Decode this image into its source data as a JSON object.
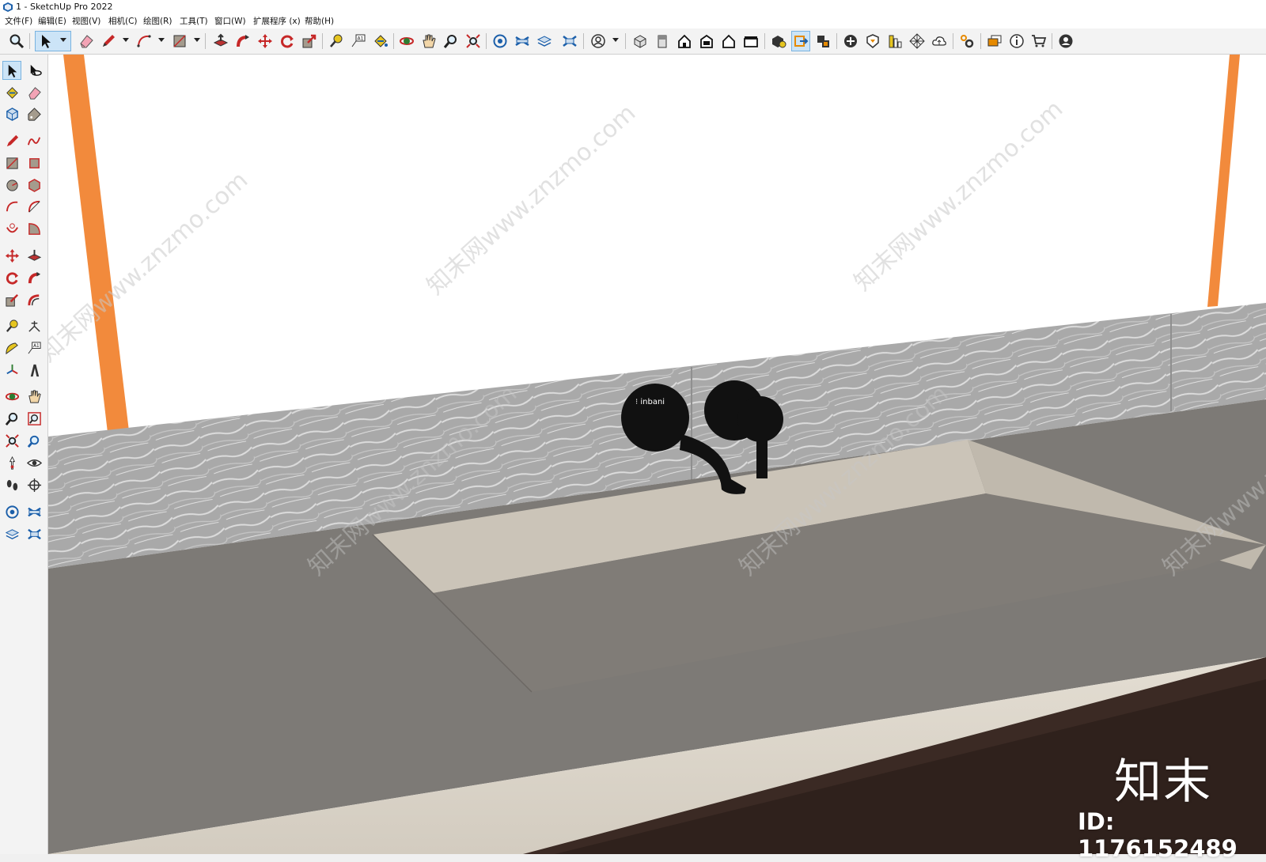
{
  "window": {
    "title": "1 - SketchUp Pro 2022"
  },
  "menu": [
    "文件(F)",
    "编辑(E)",
    "视图(V)",
    "相机(C)",
    "绘图(R)",
    "工具(T)",
    "窗口(W)",
    "扩展程序 (x)",
    "帮助(H)"
  ],
  "toolbar": {
    "tools": [
      "zoom-icon",
      "select-icon",
      "eraser-icon",
      "pencil-icon",
      "arc-icon",
      "rectangle-icon",
      "push-pull-icon",
      "follow-me-icon",
      "move-icon",
      "rotate-icon",
      "scale-icon",
      "tape-measure-icon",
      "text-icon",
      "paint-bucket-icon",
      "orbit-icon",
      "pan-icon",
      "zoom-icon-2",
      "zoom-extents-icon",
      "3d-warehouse-icon",
      "extension-warehouse-icon",
      "layout-icon",
      "extension-manager-icon",
      "profile-icon",
      "iso-view-icon",
      "top-view-icon",
      "front-view-icon",
      "right-view-icon",
      "back-view-icon",
      "left-view-icon",
      "solid-inspector-icon",
      "section-plane-icon",
      "display-section-icon",
      "add-location-icon",
      "sandbox-icon",
      "shadows-icon",
      "styles-icon",
      "cloud-icon",
      "preferences-icon",
      "entity-info-icon",
      "model-info-icon",
      "store-icon",
      "account-icon"
    ]
  },
  "left_toolbar": {
    "tools": [
      "select-icon",
      "orbit-icon",
      "paint-bucket-icon",
      "eraser-icon",
      "make-component-icon",
      "tag-icon",
      "line-icon",
      "freehand-icon",
      "rectangle-icon",
      "rotated-rectangle-icon",
      "circle-icon",
      "polygon-icon",
      "arc-icon",
      "two-point-arc-icon",
      "three-point-arc-icon",
      "pie-icon",
      "move-icon",
      "push-pull-icon",
      "rotate-icon",
      "follow-me-icon",
      "scale-icon",
      "offset-icon",
      "tape-measure-icon",
      "dimension-icon",
      "protractor-icon",
      "text-icon",
      "axes-icon",
      "3d-text-icon",
      "orbit-icon-2",
      "pan-icon",
      "zoom-icon",
      "zoom-window-icon",
      "zoom-extents-icon",
      "previous-view-icon",
      "position-camera-icon",
      "look-around-icon",
      "walk-icon",
      "section-plane-icon",
      "warehouse-icon",
      "extension-warehouse-icon",
      "layout-send-icon",
      "extension-manager-icon"
    ]
  },
  "scene": {
    "faucet_logo": "⁝ inbani",
    "watermark": "知末网www.znzmo.com",
    "brand": "知末",
    "id_label": "ID: 1176152489"
  },
  "colors": {
    "accent_orange": "#f28a3c",
    "counter_top": "#7d7a76",
    "basin": "#cbc4b8",
    "cabinet": "#ddd7cc",
    "floor": "#3b2a24",
    "faucet": "#111111"
  }
}
